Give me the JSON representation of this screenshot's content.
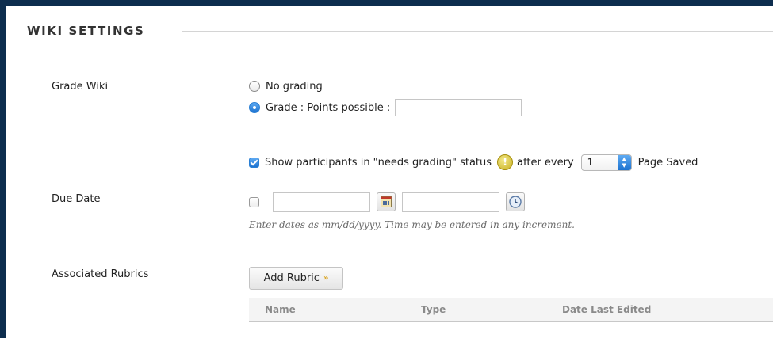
{
  "section": {
    "title": "WIKI SETTINGS"
  },
  "grade_wiki": {
    "label": "Grade Wiki",
    "options": [
      {
        "label": "No grading",
        "selected": false
      },
      {
        "label": "Grade : Points possible :",
        "selected": true
      }
    ],
    "points_possible_value": ""
  },
  "needs_grading": {
    "checked": true,
    "label": "Show participants in \"needs grading\" status",
    "icon": "warning-icon",
    "after_label": "after every",
    "count_value": "1",
    "suffix_label": "Page Saved"
  },
  "due_date": {
    "label": "Due Date",
    "enabled": false,
    "date_value": "",
    "time_value": "",
    "date_icon": "calendar-icon",
    "time_icon": "clock-icon",
    "hint": "Enter dates as mm/dd/yyyy. Time may be entered in any increment."
  },
  "rubrics": {
    "label": "Associated Rubrics",
    "add_button": "Add Rubric",
    "add_button_icon": "double-chevron-down-icon",
    "columns": [
      "Name",
      "Type",
      "Date Last Edited"
    ]
  },
  "colors": {
    "frame": "#0d2d4e",
    "accent": "#1d73d0",
    "warning": "#d4bc30",
    "rubric_chevron": "#d9a21b"
  }
}
